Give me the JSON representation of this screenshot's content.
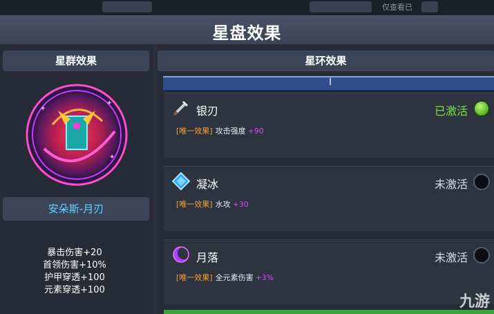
{
  "window": {
    "title": "星盘效果"
  },
  "top_strip": {
    "left_text": "仅查看已"
  },
  "left_panel": {
    "header": "星群效果",
    "constellation_name": "安朵斯-月刃",
    "stats": [
      "暴击伤害+20",
      "首领伤害+10%",
      "护甲穿透+100",
      "元素穿透+100"
    ]
  },
  "right_panel": {
    "header": "星环效果",
    "progress": {
      "cursor_label": "I"
    },
    "effects": [
      {
        "name": "银刃",
        "icon": "sword-icon",
        "status": "已激活",
        "active": true,
        "tag": "[唯一效果]",
        "desc": "攻击强度",
        "value": "+90"
      },
      {
        "name": "凝冰",
        "icon": "ice-crystal-icon",
        "status": "未激活",
        "active": false,
        "tag": "[唯一效果]",
        "desc": "水攻",
        "value": "+30"
      },
      {
        "name": "月落",
        "icon": "crescent-moon-icon",
        "status": "未激活",
        "active": false,
        "tag": "[唯一效果]",
        "desc": "全元素伤害",
        "value": "+3%"
      }
    ]
  },
  "watermark": "九游",
  "colors": {
    "active": "#7de046",
    "accent_cyan": "#5fd7ff",
    "tag_orange": "#f2a33a",
    "value_purple": "#d24ef5"
  }
}
